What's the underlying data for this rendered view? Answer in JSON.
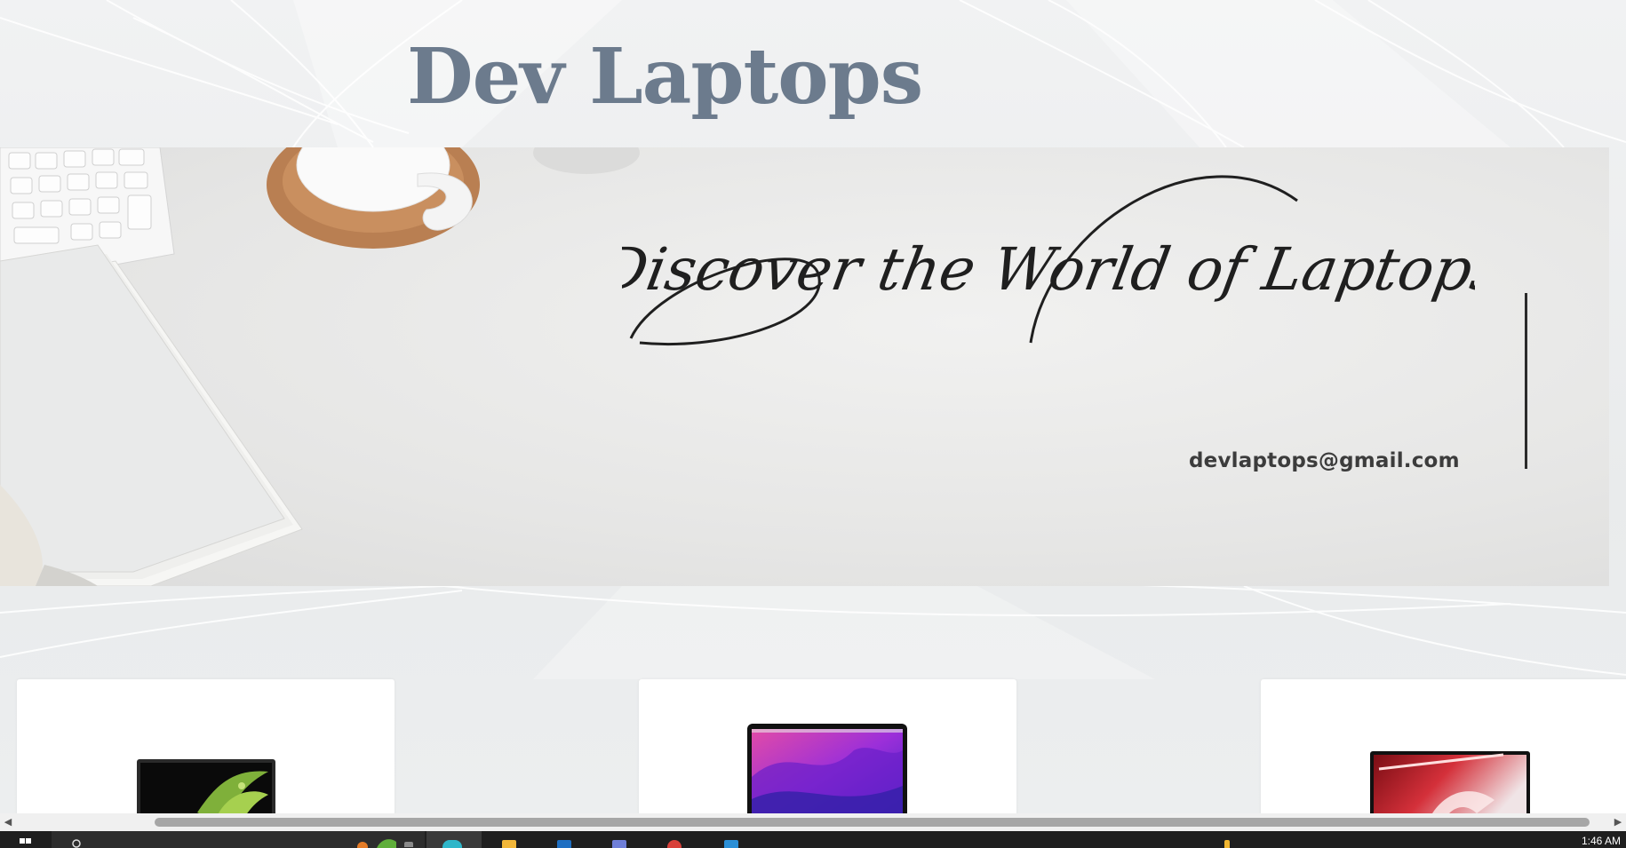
{
  "site": {
    "title": "Dev Laptops"
  },
  "banner": {
    "heading": "Discover the World of Laptops",
    "email": "devlaptops@gmail.com"
  },
  "products": [
    {
      "image_icon": "acer-laptop-image",
      "screen_color": "#0f0f0f",
      "accent_color": "#7fb03a"
    },
    {
      "image_icon": "macbook-laptop-image",
      "screen_color": "#8a2be2",
      "accent_color": "#e24ba7"
    },
    {
      "image_icon": "asus-rog-laptop-image",
      "screen_color": "#c0202a",
      "accent_color": "#f2d6d6"
    }
  ],
  "taskbar": {
    "time": "1:46 AM"
  },
  "colors": {
    "title": "#6c7b8d",
    "page_bg": "#eef0f1",
    "taskbar_bg": "#1f1f1f"
  }
}
